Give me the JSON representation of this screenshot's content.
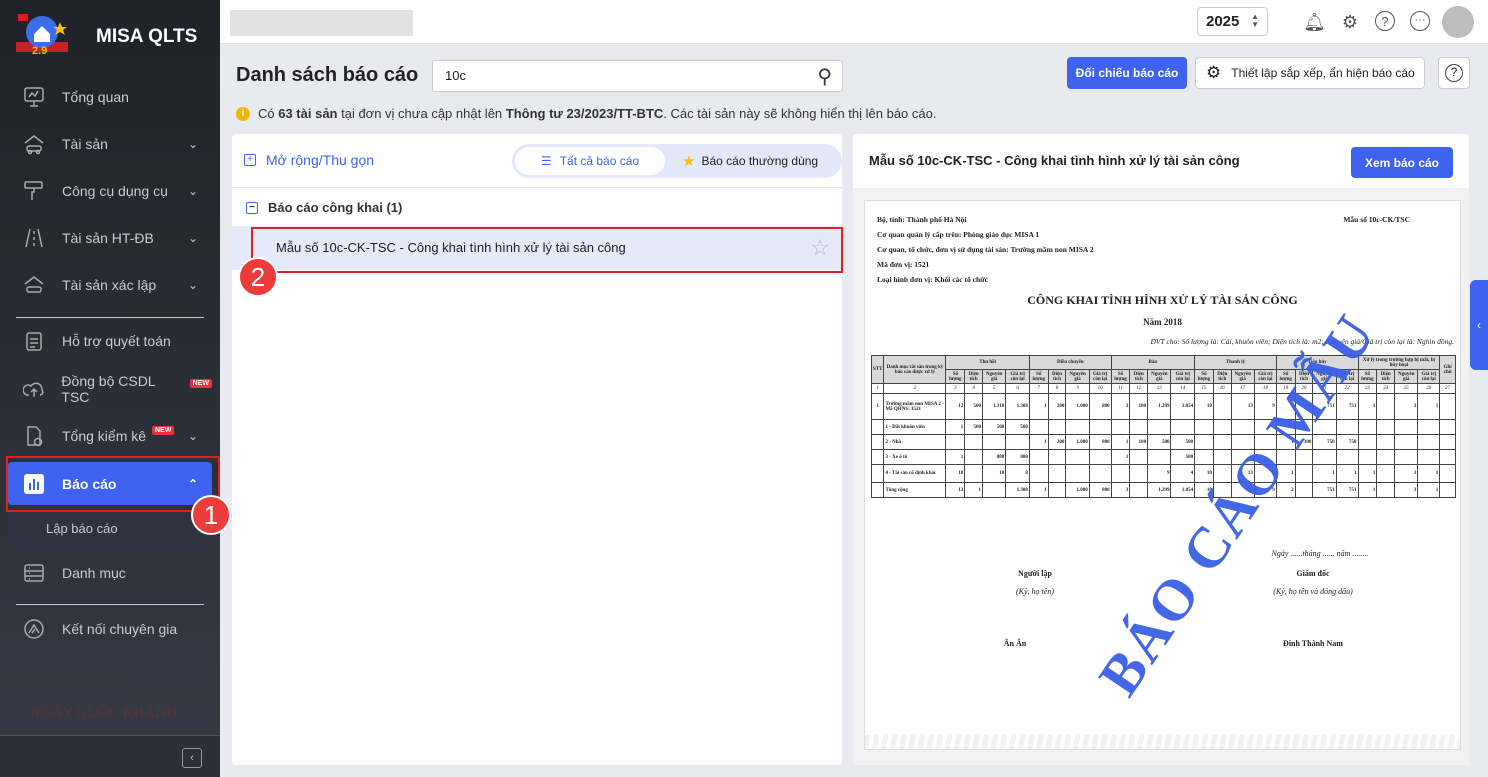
{
  "app": {
    "brand": "MISA QLTS",
    "logo_text": "2.9",
    "banner_text": "NGÀY QUỐC KHÁNH"
  },
  "sidebar": {
    "items": [
      {
        "label": "Tổng quan",
        "icon": "monitor-chart-icon"
      },
      {
        "label": "Tài sản",
        "icon": "house-car-icon"
      },
      {
        "label": "Công cụ dụng cụ",
        "icon": "paint-roller-icon"
      },
      {
        "label": "Tài sản HT-ĐB",
        "icon": "road-icon"
      },
      {
        "label": "Tài sản xác lập",
        "icon": "house-car-icon"
      },
      {
        "label": "Hỗ trợ quyết toán",
        "icon": "clipboard-icon"
      },
      {
        "label": "Đồng bộ CSDL TSC",
        "icon": "cloud-upload-icon",
        "badge": "NEW"
      },
      {
        "label": "Tổng kiểm kê",
        "icon": "document-check-icon",
        "badge": "NEW"
      },
      {
        "label": "Báo cáo",
        "icon": "bar-chart-icon"
      },
      {
        "label": "Danh mục",
        "icon": "list-icon"
      },
      {
        "label": "Kết nối chuyên gia",
        "icon": "expert-icon"
      }
    ],
    "sub_item": "Lập báo cáo"
  },
  "callouts": {
    "one": "1",
    "two": "2"
  },
  "topbar": {
    "year": "2025"
  },
  "page": {
    "title": "Danh sách báo cáo",
    "search_value": "10c",
    "compare_button": "Đối chiếu báo cáo",
    "settings_button": "Thiết lập sắp xếp, ẩn hiện báo cáo",
    "notice": {
      "pre": "Có ",
      "count": "63 tài sản",
      "mid": " tại đơn vị chưa cập nhật lên ",
      "circular": "Thông tư 23/2023/TT-BTC",
      "post": ". Các tài sản này sẽ không hiển thị lên báo cáo."
    }
  },
  "list": {
    "expand_label": "Mở rộng/Thu gọn",
    "tab_all": "Tất cả báo cáo",
    "tab_fav": "Báo cáo thường dùng",
    "group": "Báo cáo công khai (1)",
    "item": "Mẫu số 10c-CK-TSC - Công khai tình hình xử lý tài sản công"
  },
  "preview": {
    "title": "Mẫu số 10c-CK-TSC - Công khai tình hình xử lý tài sản công",
    "view_button": "Xem báo cáo",
    "report": {
      "meta": [
        "Bộ, tỉnh: Thành phố Hà Nội",
        "Cơ quan quản lý cấp trên: Phòng giáo dục MISA 1",
        "Cơ quan, tổ chức, đơn vị sử dụng tài sản: Trường mầm non MISA 2",
        "Mã đơn vị: 1521",
        "Loại hình đơn vị: Khối các tổ chức"
      ],
      "form_no": "Mẫu số 10c-CK/TSC",
      "title": "CÔNG KHAI TÌNH HÌNH XỬ LÝ TÀI SẢN CÔNG",
      "year": "Năm 2018",
      "unit": "ĐVT cho: Số lượng là: Cái, khuôn viên; Diện tích là: m2; Nguyên giá/Giá trị còn lại là: Nghìn đồng.",
      "h_stt": "STT",
      "h_cat": "Danh mục tài sản trong kỳ báo cáo được xử lý",
      "h_note": "Ghi chú",
      "groups": [
        "Thu hồi",
        "Điều chuyển",
        "Bán",
        "Thanh lý",
        "Tiêu hủy",
        "Xử lý trong trường hợp bị mất, bị hủy hoại"
      ],
      "subs": [
        "Số lượng",
        "Diện tích",
        "Nguyên giá",
        "Giá trị còn lại"
      ],
      "rows": [
        [
          "1",
          "Trường mầm non MISA 2 - Mã QHNS: 1521",
          "12",
          "500",
          "1.310",
          "1.308",
          "1",
          "200",
          "1.000",
          "800",
          "3",
          "180",
          "1.299",
          "1.054",
          "10",
          "",
          "13",
          "9",
          "2",
          "300",
          "751",
          "751",
          "1",
          "",
          "3",
          "1",
          ""
        ],
        [
          "",
          "1 - Đất khuôn viên",
          "1",
          "500",
          "500",
          "500",
          "",
          "",
          "",
          "",
          "",
          "",
          "",
          "",
          "",
          "",
          "",
          "",
          "",
          "",
          "",
          "",
          "",
          "",
          "",
          "",
          ""
        ],
        [
          "",
          "2 - Nhà",
          "",
          "",
          "",
          "",
          "1",
          "200",
          "1.000",
          "800",
          "1",
          "100",
          "500",
          "500",
          "",
          "",
          "",
          "",
          "1",
          "300",
          "750",
          "750",
          "",
          "",
          "",
          "",
          ""
        ],
        [
          "",
          "3 - Xe ô tô",
          "1",
          "",
          "800",
          "800",
          "",
          "",
          "",
          "",
          "1",
          "",
          "",
          "580",
          "",
          "",
          "",
          "",
          "",
          "",
          "",
          "",
          "",
          "",
          "",
          "",
          ""
        ],
        [
          "",
          "4 - Tài sản cố định khác",
          "10",
          "",
          "10",
          "8",
          "",
          "",
          "",
          "",
          "",
          "",
          "9",
          "4",
          "10",
          "",
          "13",
          "9",
          "1",
          "",
          "1",
          "1",
          "1",
          "",
          "3",
          "1",
          ""
        ],
        [
          "",
          "Tổng cộng",
          "12",
          "1",
          "",
          "1.308",
          "1",
          "",
          "1.000",
          "800",
          "3",
          "",
          "1.299",
          "1.054",
          "10",
          "",
          "13",
          "9",
          "2",
          "",
          "751",
          "751",
          "1",
          "",
          "3",
          "1",
          ""
        ]
      ],
      "date_line": "Ngày ......tháng ...... năm ........",
      "preparer": "Người lập",
      "preparer_note": "(Ký, họ tên)",
      "preparer_name": "Ân Ân",
      "director": "Giám đốc",
      "director_note": "(Ký, họ tên và đóng dấu)",
      "director_name": "Đinh Thành Nam",
      "watermark": "BÁO CÁO MẪU"
    }
  }
}
